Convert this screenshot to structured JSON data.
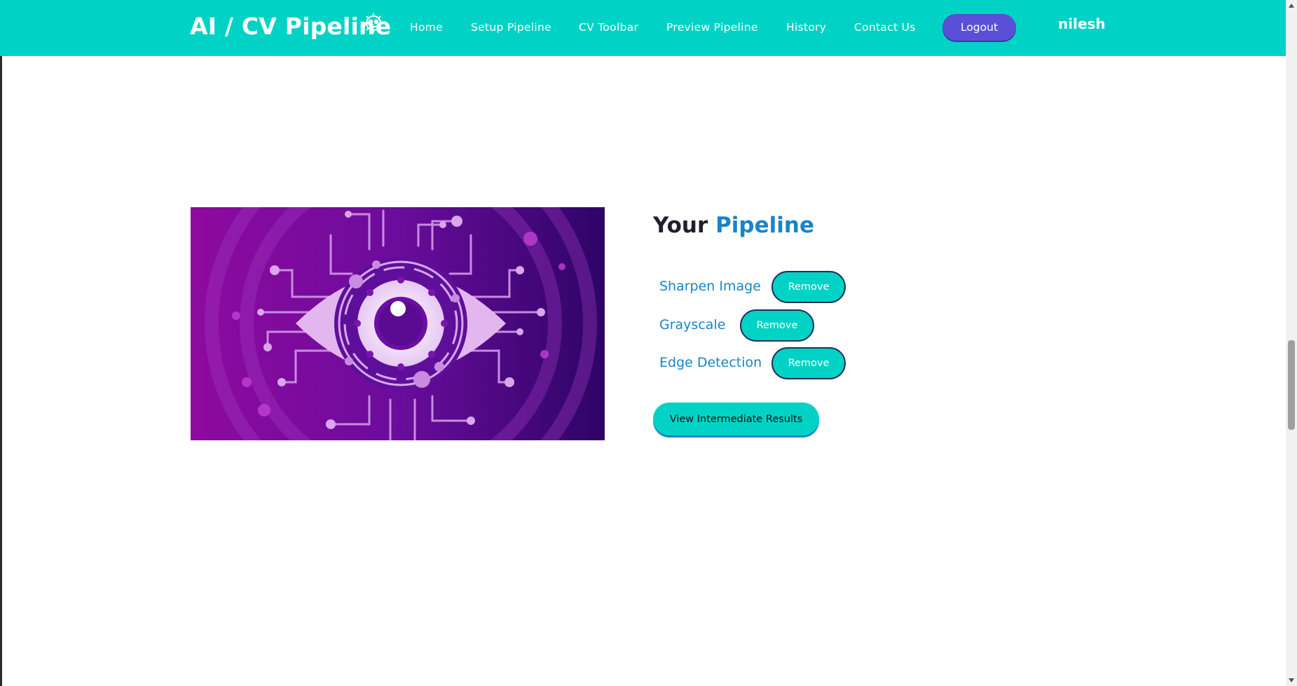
{
  "header": {
    "brand": "AI / CV Pipeline",
    "brand_icon": "robot-gear-icon",
    "nav": {
      "home": "Home",
      "setup_pipeline": "Setup Pipeline",
      "cv_toolbar": "CV Toolbar",
      "preview_pipeline": "Preview Pipeline",
      "history": "History",
      "contact_us": "Contact Us"
    },
    "logout_label": "Logout",
    "username": "nilesh"
  },
  "pipeline": {
    "title_part1": "Your",
    "title_part2": "Pipeline",
    "steps": [
      {
        "label": "Sharpen Image",
        "remove_label": "Remove"
      },
      {
        "label": "Grayscale",
        "remove_label": "Remove"
      },
      {
        "label": "Edge Detection",
        "remove_label": "Remove"
      }
    ],
    "view_results_label": "View Intermediate Results"
  },
  "hero_image": "cyber-eye-illustration",
  "colors": {
    "navbar": "#00d3c5",
    "logout": "#5a4fd6",
    "accent_text": "#1a84c6",
    "button": "#00d3c5"
  }
}
